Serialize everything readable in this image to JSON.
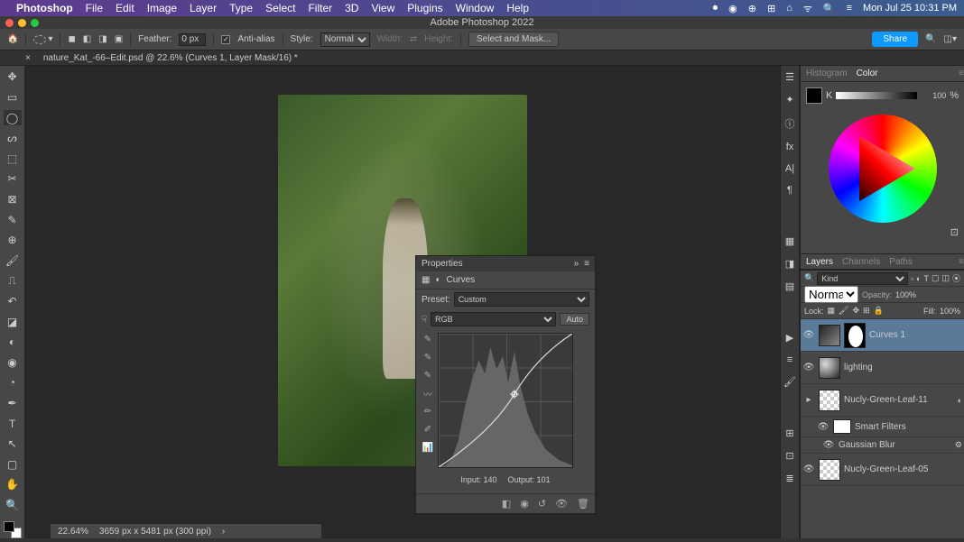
{
  "system": {
    "menubar": [
      "Photoshop",
      "File",
      "Edit",
      "Image",
      "Layer",
      "Type",
      "Select",
      "Filter",
      "3D",
      "View",
      "Plugins",
      "Window",
      "Help"
    ],
    "clock": "Mon Jul 25  10:31 PM"
  },
  "window": {
    "title": "Adobe Photoshop 2022"
  },
  "options_bar": {
    "feather_label": "Feather:",
    "feather_value": "0 px",
    "antialias_label": "Anti-alias",
    "antialias_checked": true,
    "style_label": "Style:",
    "style_value": "Normal",
    "width_label": "Width:",
    "height_label": "Height:",
    "select_mask": "Select and Mask...",
    "share": "Share"
  },
  "document": {
    "tab_title": "nature_Kat_-66–Edit.psd @ 22.6% (Curves 1, Layer Mask/16) *"
  },
  "properties": {
    "title": "Properties",
    "adjustment": "Curves",
    "preset_label": "Preset:",
    "preset_value": "Custom",
    "channel_value": "RGB",
    "auto": "Auto",
    "input_label": "Input:",
    "input_value": "140",
    "output_label": "Output:",
    "output_value": "101"
  },
  "color": {
    "tab_histogram": "Histogram",
    "tab_color": "Color",
    "k_label": "K",
    "k_value": "100",
    "k_unit": "%"
  },
  "layers": {
    "tab_layers": "Layers",
    "tab_channels": "Channels",
    "tab_paths": "Paths",
    "kind_label": "Kind",
    "blend_mode": "Normal",
    "opacity_label": "Opacity:",
    "opacity_value": "100%",
    "lock_label": "Lock:",
    "fill_label": "Fill:",
    "fill_value": "100%",
    "items": [
      {
        "name": "Curves 1",
        "type": "adjustment",
        "selected": true,
        "visible": true
      },
      {
        "name": "lighting",
        "type": "raster",
        "visible": true
      },
      {
        "name": "Nucly-Green-Leaf-11",
        "type": "smartobject",
        "visible": true,
        "expanded": true
      },
      {
        "name": "Smart Filters",
        "type": "filter_header",
        "visible": true
      },
      {
        "name": "Gaussian Blur",
        "type": "effect",
        "visible": true
      },
      {
        "name": "Nucly-Green-Leaf-05",
        "type": "smartobject",
        "visible": true
      }
    ]
  },
  "status": {
    "zoom": "22.64%",
    "doc_size": "3659 px x 5481 px (300 ppi)"
  }
}
